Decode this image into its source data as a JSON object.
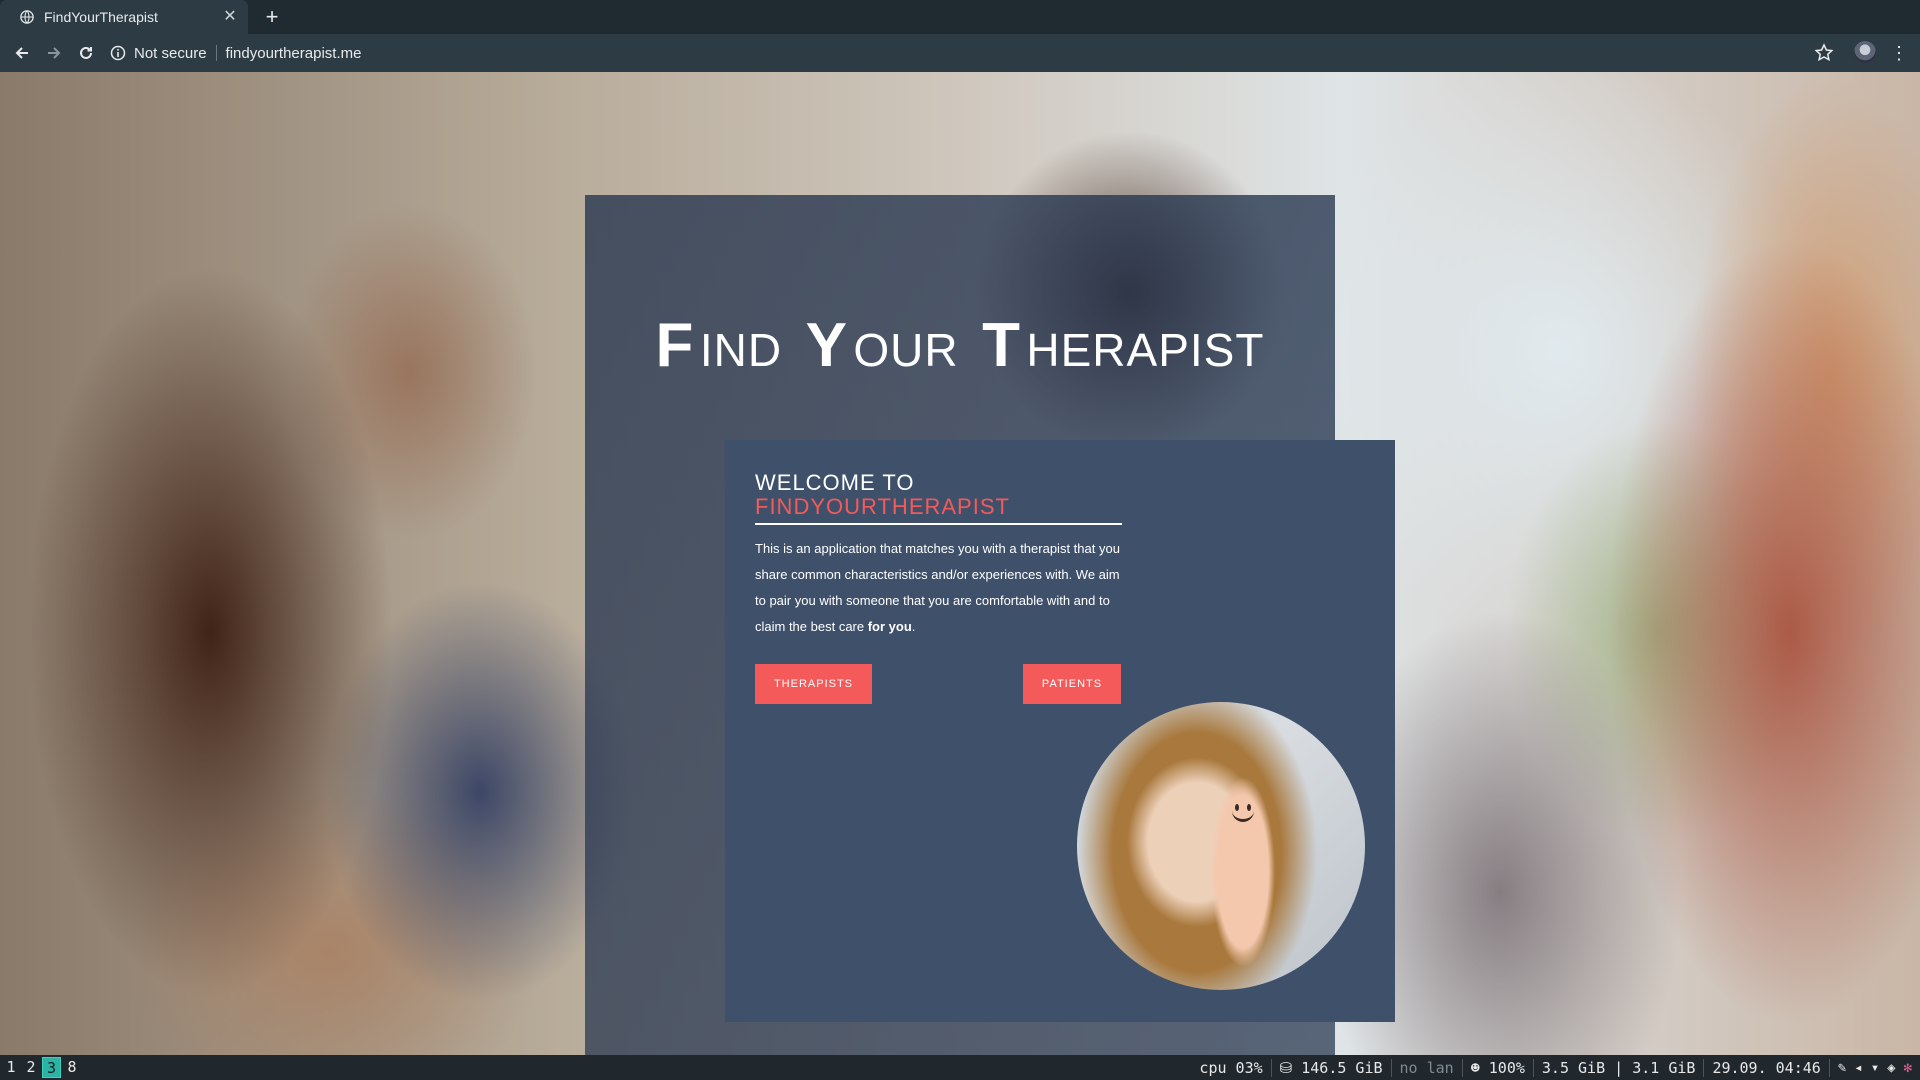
{
  "browser": {
    "tab_title": "FindYourTherapist",
    "tab_close": "✕",
    "new_tab": "+",
    "security_label": "Not secure",
    "url": "findyourtherapist.me"
  },
  "page": {
    "hero": {
      "f_cap": "F",
      "f_rest": "IND",
      "y_cap": "Y",
      "y_rest": "OUR",
      "t_cap": "T",
      "t_rest": "HERAPIST"
    },
    "card": {
      "welcome_line1": "WELCOME TO",
      "welcome_line2": "FINDYOURTHERAPIST",
      "description_main": "This is an application that matches you with a therapist that you share common characteristics and/or experiences with. We aim to pair you with someone that you are comfortable with and to claim the best care ",
      "description_bold": "for you",
      "description_end": ".",
      "therapists_button": "THERAPISTS",
      "patients_button": "PATIENTS"
    },
    "accent_color": "#f45a5a",
    "card_color": "#3f506b"
  },
  "statusbar": {
    "workspaces": [
      "1",
      "2",
      "3",
      "8"
    ],
    "active_workspace": "3",
    "cpu": "cpu  03%",
    "disk": "⛁ 146.5 GiB",
    "lan": "no lan",
    "battery": "☻ 100%",
    "memory": "3.5 GiB | 3.1 GiB",
    "datetime": "29.09. 04:46"
  }
}
